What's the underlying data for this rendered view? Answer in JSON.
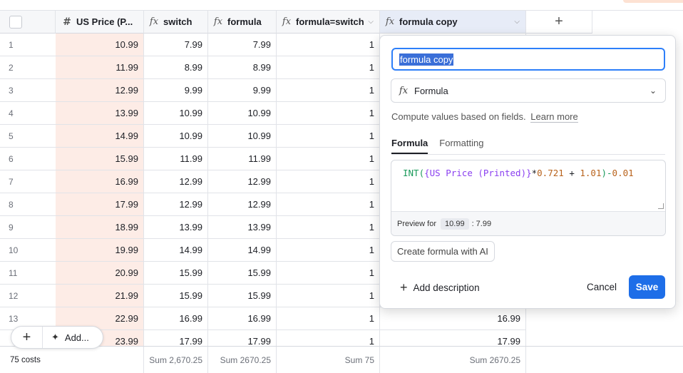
{
  "columns": [
    {
      "label": "",
      "type": "checkbox"
    },
    {
      "label": "US Price (P...",
      "icon": "number-icon"
    },
    {
      "label": "switch",
      "icon": "formula-icon"
    },
    {
      "label": "formula",
      "icon": "formula-icon"
    },
    {
      "label": "formula=switch",
      "icon": "formula-icon"
    },
    {
      "label": "formula copy",
      "icon": "formula-icon"
    }
  ],
  "add_column_label": "+",
  "rows": [
    {
      "n": "1",
      "price": "10.99",
      "switch": "7.99",
      "formula": "7.99",
      "eq": "1",
      "copy": ""
    },
    {
      "n": "2",
      "price": "11.99",
      "switch": "8.99",
      "formula": "8.99",
      "eq": "1",
      "copy": ""
    },
    {
      "n": "3",
      "price": "12.99",
      "switch": "9.99",
      "formula": "9.99",
      "eq": "1",
      "copy": ""
    },
    {
      "n": "4",
      "price": "13.99",
      "switch": "10.99",
      "formula": "10.99",
      "eq": "1",
      "copy": ""
    },
    {
      "n": "5",
      "price": "14.99",
      "switch": "10.99",
      "formula": "10.99",
      "eq": "1",
      "copy": ""
    },
    {
      "n": "6",
      "price": "15.99",
      "switch": "11.99",
      "formula": "11.99",
      "eq": "1",
      "copy": ""
    },
    {
      "n": "7",
      "price": "16.99",
      "switch": "12.99",
      "formula": "12.99",
      "eq": "1",
      "copy": ""
    },
    {
      "n": "8",
      "price": "17.99",
      "switch": "12.99",
      "formula": "12.99",
      "eq": "1",
      "copy": ""
    },
    {
      "n": "9",
      "price": "18.99",
      "switch": "13.99",
      "formula": "13.99",
      "eq": "1",
      "copy": ""
    },
    {
      "n": "10",
      "price": "19.99",
      "switch": "14.99",
      "formula": "14.99",
      "eq": "1",
      "copy": ""
    },
    {
      "n": "11",
      "price": "20.99",
      "switch": "15.99",
      "formula": "15.99",
      "eq": "1",
      "copy": ""
    },
    {
      "n": "12",
      "price": "21.99",
      "switch": "15.99",
      "formula": "15.99",
      "eq": "1",
      "copy": ""
    },
    {
      "n": "13",
      "price": "22.99",
      "switch": "16.99",
      "formula": "16.99",
      "eq": "1",
      "copy": "16.99"
    },
    {
      "n": "",
      "price": "23.99",
      "switch": "17.99",
      "formula": "17.99",
      "eq": "1",
      "copy": "17.99"
    }
  ],
  "footer": {
    "count": "75 costs",
    "switch_sum": "Sum 2,670.25",
    "formula_sum": "Sum 2670.25",
    "eq_sum": "Sum 75",
    "copy_sum": "Sum 2670.25"
  },
  "float_bar": {
    "plus": "+",
    "add_label": "Add..."
  },
  "dialog": {
    "field_name": "formula copy",
    "field_type": "Formula",
    "description": "Compute values based on fields.",
    "learn_more": "Learn more",
    "tabs": [
      "Formula",
      "Formatting"
    ],
    "formula_parts": {
      "fn": "INT(",
      "field": "{US Price (Printed)}",
      "mul": "*",
      "n1": "0.721",
      "plus": " + ",
      "n2": "1.01",
      "close": ")-",
      "n3": "0.01"
    },
    "preview_label": "Preview for",
    "preview_input": "10.99",
    "preview_result": ": 7.99",
    "ai_button": "Create formula with AI",
    "add_description": "Add description",
    "cancel": "Cancel",
    "save": "Save"
  },
  "colors": {
    "accent": "#1e6ee8",
    "price_column_bg": "#fdece6",
    "selected_header_bg": "#e7ecf7"
  }
}
